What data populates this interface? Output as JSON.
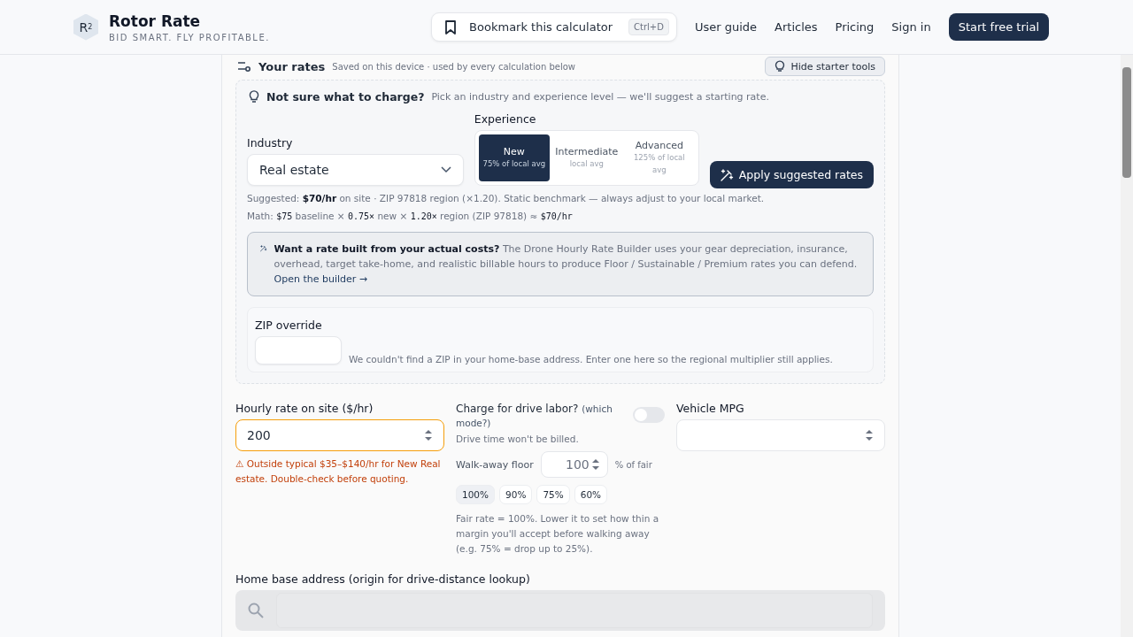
{
  "header": {
    "brand": {
      "logo": "R",
      "logo_sup": "2",
      "name": "Rotor Rate",
      "tagline": "BID SMART. FLY PROFITABLE."
    },
    "bookmark": {
      "label": "Bookmark this calculator",
      "shortcut": "Ctrl+D"
    },
    "nav": [
      "User guide",
      "Articles",
      "Pricing",
      "Sign in"
    ],
    "cta": "Start free trial"
  },
  "rates": {
    "title": "Your rates",
    "note": "Saved on this device · used by every calculation below",
    "hide_button": "Hide starter tools"
  },
  "starter": {
    "title": "Not sure what to charge?",
    "text": "Pick an industry and experience level — we'll suggest a starting rate.",
    "industry": {
      "label": "Industry",
      "value": "Real estate"
    },
    "experience": {
      "label": "Experience",
      "options": [
        {
          "label": "New",
          "sub": "75% of local avg",
          "selected": true
        },
        {
          "label": "Intermediate",
          "sub": "local avg",
          "selected": false
        },
        {
          "label": "Advanced",
          "sub": "125% of local avg",
          "selected": false
        }
      ]
    },
    "apply_button": "Apply suggested rates",
    "suggested": "Suggested: **$70/hr** on site · ZIP 97818 region (×1.20). Static benchmark — always adjust to your local market.",
    "math": [
      {
        "kind": "plain",
        "text": "Math: "
      },
      {
        "kind": "mono",
        "text": "$75"
      },
      {
        "kind": "plain",
        "text": " baseline × "
      },
      {
        "kind": "mono",
        "text": "0.75×"
      },
      {
        "kind": "plain",
        "text": " new × "
      },
      {
        "kind": "mono",
        "text": "1.20×"
      },
      {
        "kind": "plain",
        "text": " region (ZIP 97818) ≈ "
      },
      {
        "kind": "mono",
        "text": "$70/hr"
      }
    ],
    "builder": {
      "text": "**Want a rate built from your actual costs?** The Drone Hourly Rate Builder uses your gear depreciation, insurance, overhead, target take-home, and realistic billable hours to produce Floor / Sustainable / Premium rates you can defend.",
      "link": "Open the builder →"
    },
    "zip": {
      "label": "ZIP override",
      "note": "We couldn't find a ZIP in your home-base address. Enter one here so the regional multiplier still applies."
    }
  },
  "hourly": {
    "label": "Hourly rate on site ($/hr)",
    "value": "200",
    "warning": "⚠ Outside typical $35–$140/hr for New Real estate. Double-check before quoting."
  },
  "drive": {
    "label": "Charge for drive labor?",
    "hint": "(which mode?)",
    "on": false,
    "note": "Drive time won't be billed."
  },
  "floor": {
    "label": "Walk-away floor",
    "value": "100",
    "unit": "% of fair",
    "presets": [
      {
        "label": "100%",
        "selected": true
      },
      {
        "label": "90%",
        "selected": false
      },
      {
        "label": "75%",
        "selected": false
      },
      {
        "label": "60%",
        "selected": false
      }
    ],
    "note": "Fair rate = 100%. Lower it to set how thin a margin you'll accept before walking away (e.g. 75% = drop up to 25%)."
  },
  "mpg": {
    "label": "Vehicle MPG"
  },
  "home": {
    "label": "Home base address (origin for drive-distance lookup)"
  }
}
